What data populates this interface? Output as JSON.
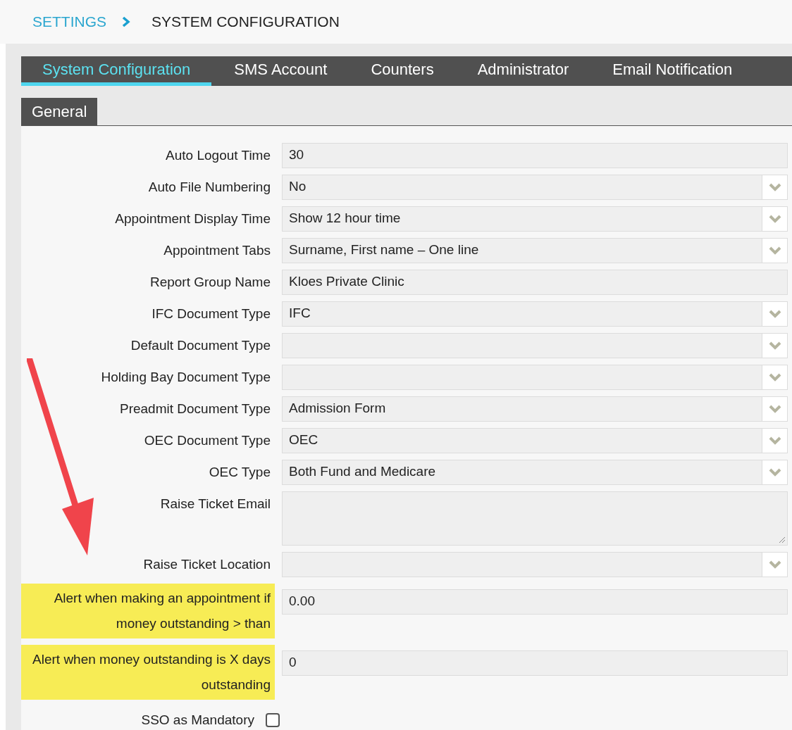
{
  "breadcrumb": {
    "parent": "SETTINGS",
    "current": "SYSTEM CONFIGURATION"
  },
  "tabs": [
    {
      "label": "System Configuration",
      "selected": true
    },
    {
      "label": "SMS Account",
      "selected": false
    },
    {
      "label": "Counters",
      "selected": false
    },
    {
      "label": "Administrator",
      "selected": false
    },
    {
      "label": "Email Notification",
      "selected": false
    }
  ],
  "sub_tabs": [
    {
      "label": "General",
      "selected": true
    }
  ],
  "fields": [
    {
      "kind": "text",
      "label": "Auto Logout Time",
      "value": "30",
      "highlighted": false
    },
    {
      "kind": "select",
      "label": "Auto File Numbering",
      "value": "No",
      "highlighted": false
    },
    {
      "kind": "select",
      "label": "Appointment Display Time",
      "value": "Show 12 hour time",
      "highlighted": false
    },
    {
      "kind": "select",
      "label": "Appointment Tabs",
      "value": "Surname, First name – One line",
      "highlighted": false
    },
    {
      "kind": "text",
      "label": "Report Group Name",
      "value": "Kloes Private Clinic",
      "highlighted": false
    },
    {
      "kind": "select",
      "label": "IFC Document Type",
      "value": "IFC",
      "highlighted": false
    },
    {
      "kind": "select",
      "label": "Default Document Type",
      "highlighted": false
    },
    {
      "kind": "select",
      "label": "Holding Bay Document Type",
      "highlighted": false
    },
    {
      "kind": "select",
      "label": "Preadmit Document Type",
      "value": "Admission Form",
      "highlighted": false
    },
    {
      "kind": "select",
      "label": "OEC Document Type",
      "value": "OEC",
      "highlighted": false
    },
    {
      "kind": "select",
      "label": "OEC Type",
      "value": "Both Fund and Medicare",
      "highlighted": false
    },
    {
      "kind": "textarea",
      "label": "Raise Ticket Email",
      "highlighted": false
    },
    {
      "kind": "select",
      "label": "Raise Ticket Location",
      "highlighted": false
    },
    {
      "kind": "text",
      "label": "Alert when making an appointment if money outstanding > than",
      "value": "0.00",
      "highlighted": true
    },
    {
      "kind": "text",
      "label": "Alert when money outstanding is X days outstanding",
      "value": "0",
      "highlighted": true
    },
    {
      "kind": "checkbox",
      "label": "SSO as Mandatory",
      "checked": false,
      "highlighted": false
    }
  ]
}
